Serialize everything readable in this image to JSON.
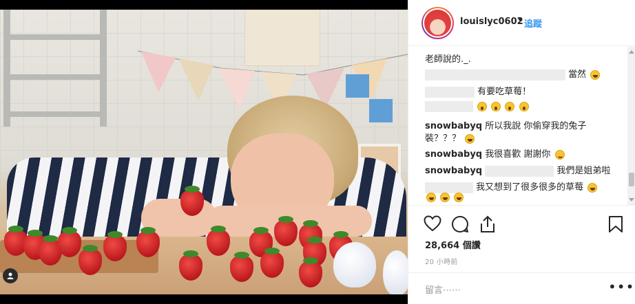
{
  "post": {
    "username": "louislyc0602",
    "separator": "•",
    "follow_label": "追蹤",
    "likes": "28,664 個讚",
    "time": "20 小時前",
    "comment_placeholder": "留言⋯⋯",
    "more_label": "•••"
  },
  "comments": [
    {
      "user": "",
      "text": "老師說的._."
    },
    {
      "user": "",
      "text": "當然"
    },
    {
      "user": "",
      "text": "有要吃草莓！"
    },
    {
      "user": "",
      "text": ""
    },
    {
      "user": "snowbabyq",
      "text": "所以我說 你偷穿我的兔子",
      "text2": "裝？？？"
    },
    {
      "user": "snowbabyq",
      "text": "我很喜歡 謝謝你"
    },
    {
      "user": "snowbabyq",
      "text": "我們是姐弟啦"
    },
    {
      "user": "",
      "text": "我又想到了很多很多的草莓"
    }
  ],
  "icons": [
    "heart-icon",
    "comment-icon",
    "share-icon",
    "bookmark-icon",
    "user-tag-icon"
  ],
  "colors": {
    "accent": "#3897f0",
    "text": "#262626",
    "muted": "#999999",
    "border": "#efefef"
  }
}
